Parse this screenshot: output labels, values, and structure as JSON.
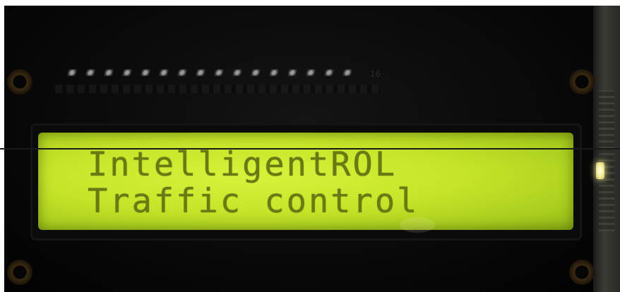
{
  "display": {
    "line1": "IntelligentROL",
    "line2": "Traffic control"
  },
  "pin_marker": "16",
  "colors": {
    "lcd_background": "#c6e52a",
    "lcd_text": "#6a7a12",
    "board": "#070707",
    "led": "#f3f0a0"
  }
}
